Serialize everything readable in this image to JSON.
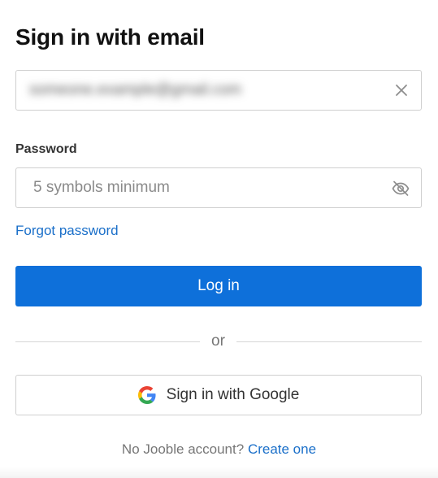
{
  "heading": "Sign in with email",
  "email": {
    "value": "someone.example@gmail.com",
    "clear_icon": "close-icon"
  },
  "password": {
    "label": "Password",
    "placeholder": "5 symbols minimum",
    "value": "",
    "toggle_icon": "eye-off-icon"
  },
  "forgot_password": "Forgot password",
  "login_button": "Log in",
  "divider_text": "or",
  "google_button": {
    "label": "Sign in with Google",
    "icon": "google-icon"
  },
  "footer": {
    "prompt": "No Jooble account?",
    "link": "Create one"
  },
  "colors": {
    "accent": "#0e70da",
    "link": "#1a6fc9",
    "border": "#cfcfcf",
    "text": "#111111",
    "muted": "#767676"
  }
}
